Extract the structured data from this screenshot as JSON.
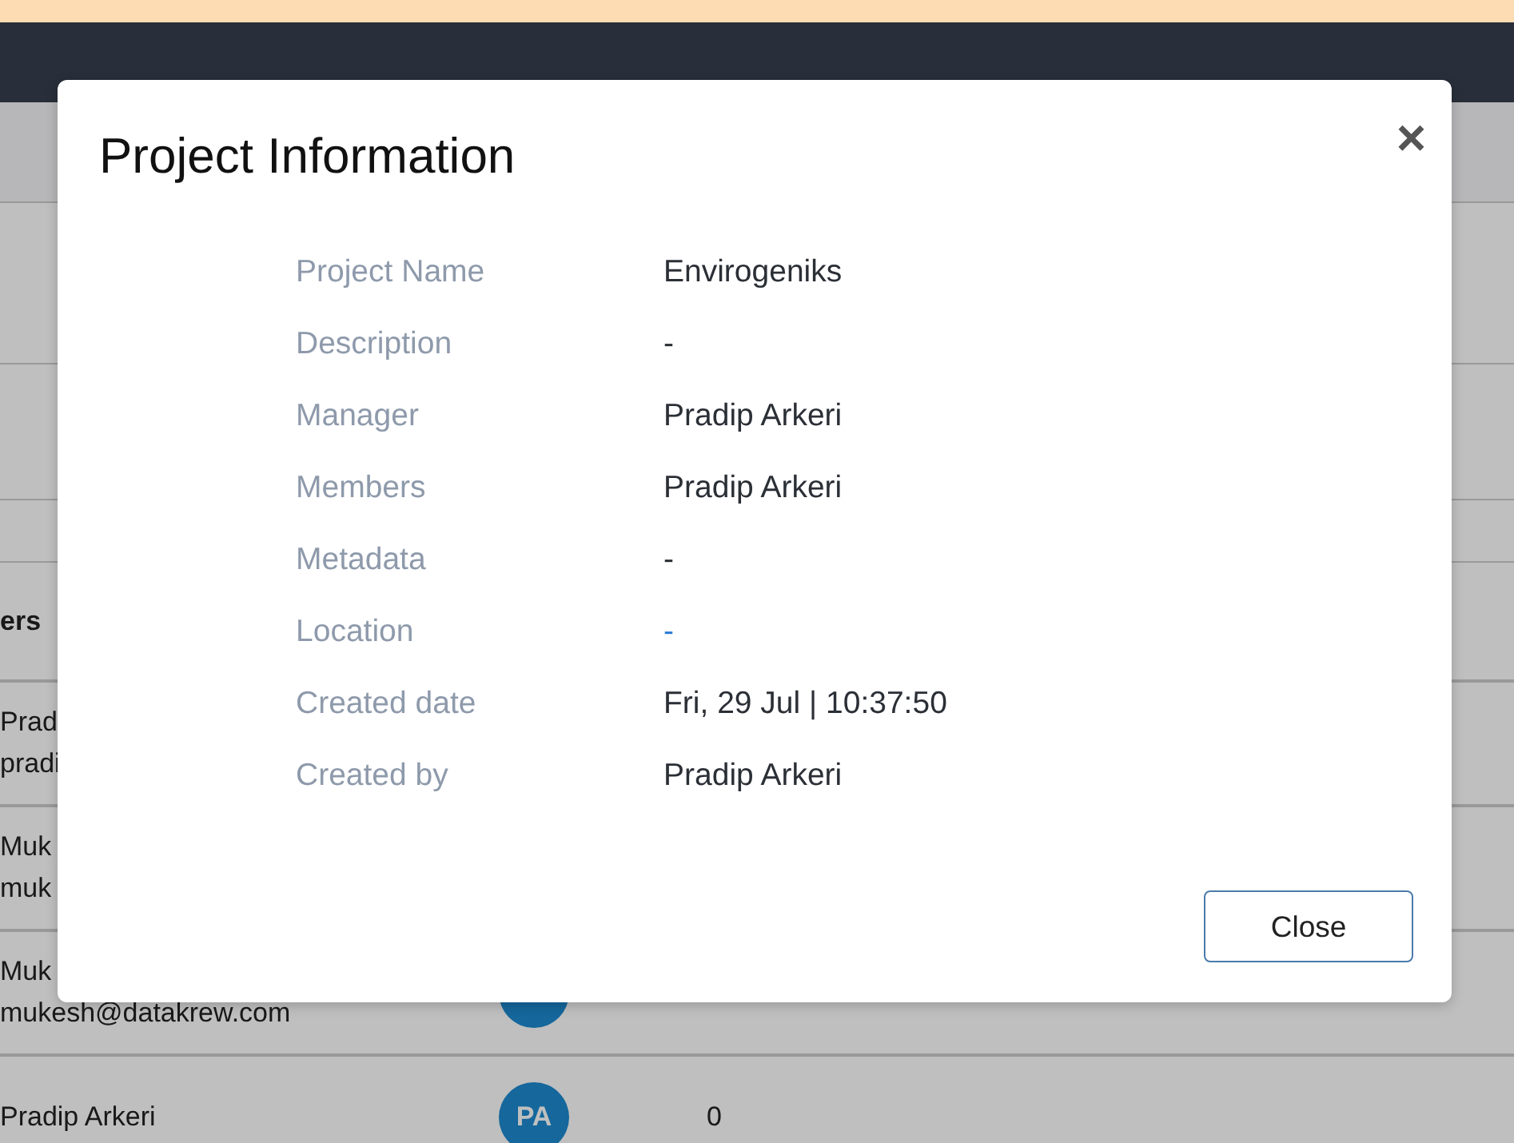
{
  "background": {
    "table_header": "ers",
    "rows": [
      {
        "line1": "Prad",
        "line2": "pradi"
      },
      {
        "line1": "Muk",
        "line2": "muk"
      },
      {
        "line1": "Muk",
        "line2": "mukesh@datakrew.com",
        "avatar": ""
      },
      {
        "line1": "Pradip Arkeri",
        "avatar": "PA",
        "count": "0"
      }
    ]
  },
  "modal": {
    "title": "Project Information",
    "close_icon": "×",
    "fields": [
      {
        "label": "Project Name",
        "value": "Envirogeniks",
        "kind": "text"
      },
      {
        "label": "Description",
        "value": "-",
        "kind": "text"
      },
      {
        "label": "Manager",
        "value": "Pradip Arkeri",
        "kind": "text"
      },
      {
        "label": "Members",
        "value": "Pradip Arkeri",
        "kind": "text"
      },
      {
        "label": "Metadata",
        "value": "-",
        "kind": "text"
      },
      {
        "label": "Location",
        "value": "-",
        "kind": "link"
      },
      {
        "label": "Created date",
        "value": "Fri, 29 Jul | 10:37:50",
        "kind": "text"
      },
      {
        "label": "Created by",
        "value": "Pradip Arkeri",
        "kind": "text"
      }
    ],
    "button": "Close"
  }
}
